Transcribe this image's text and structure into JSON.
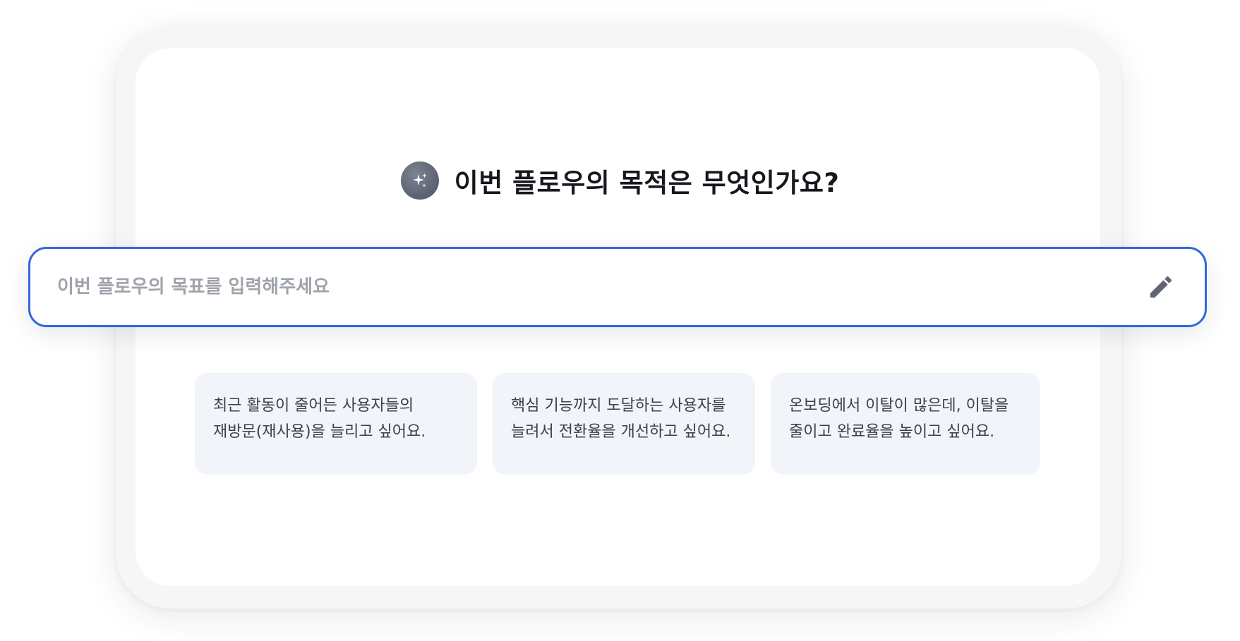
{
  "header": {
    "icon": "sparkles-icon",
    "title": "이번 플로우의 목적은 무엇인가요?"
  },
  "goal_input": {
    "value": "",
    "placeholder": "이번 플로우의 목표를 입력해주세요",
    "action_icon": "pencil-icon"
  },
  "suggestions": [
    {
      "lines": [
        "최근 활동이 줄어든 사용자들의",
        "재방문(재사용)을 늘리고 싶어요."
      ]
    },
    {
      "lines": [
        "핵심 기능까지 도달하는 사용자를",
        "늘려서 전환율을 개선하고 싶어요."
      ]
    },
    {
      "lines": [
        "온보딩에서 이탈이 많은데, 이탈을",
        "줄이고 완료율을 높이고 싶어요."
      ]
    }
  ],
  "colors": {
    "accent": "#3266e0",
    "card_bg": "#f1f4f9",
    "title": "#16181d",
    "placeholder": "#9fa3ab",
    "icon_gray": "#5f6672"
  }
}
